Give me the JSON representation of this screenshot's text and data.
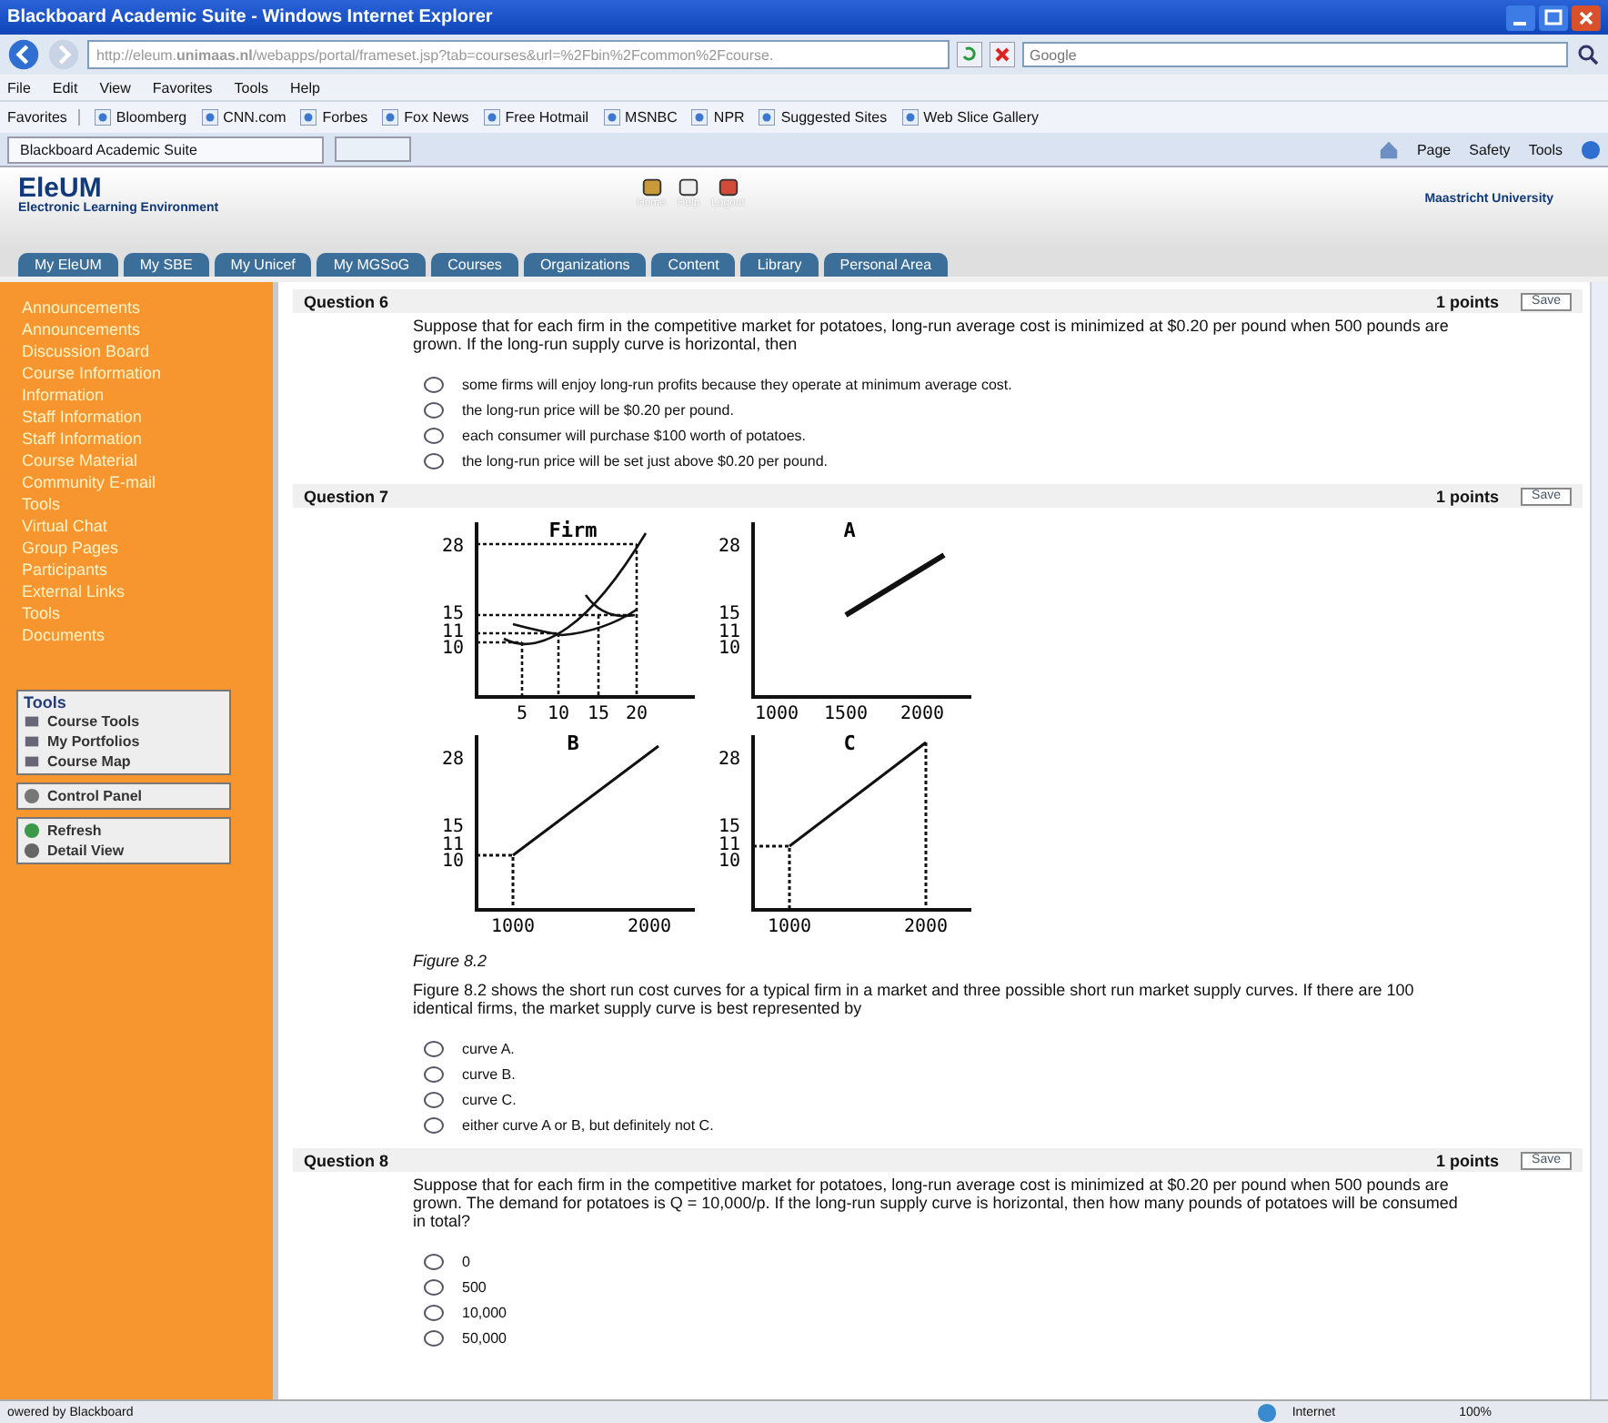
{
  "browser": {
    "title": "Blackboard Academic Suite - Windows Internet Explorer",
    "address": "http://eleum.**unimaas.nl**/webapps/portal/frameset.jsp?tab=courses&url=%2Fbin%2Fcommon%2Fcourse.",
    "search_placeholder": "Google",
    "menu": [
      "File",
      "Edit",
      "View",
      "Favorites",
      "Tools",
      "Help"
    ],
    "favorites_label": "Favorites",
    "favorites": [
      "Bloomberg",
      "CNN.com",
      "Forbes",
      "Fox News",
      "Free Hotmail",
      "MSNBC",
      "NPR",
      "Suggested Sites",
      "Web Slice Gallery"
    ],
    "tab_title": "Blackboard Academic Suite",
    "commands": [
      "Page",
      "Safety",
      "Tools"
    ]
  },
  "site": {
    "logo": "EleUM",
    "subtitle": "Electronic Learning Environment",
    "header_links": [
      "Home",
      "Help",
      "Logout"
    ],
    "university": "Maastricht University",
    "tabs": [
      "My EleUM",
      "My SBE",
      "My Unicef",
      "My MGSoG",
      "Courses",
      "Organizations",
      "Content",
      "Library",
      "Personal Area"
    ]
  },
  "sidebar": {
    "items": [
      "Announcements",
      "Announcements",
      "Discussion Board",
      "Course Information",
      "Information",
      "Staff Information",
      "Staff Information",
      "Course Material",
      "Community E-mail",
      "Tools",
      "Virtual Chat",
      "Group Pages",
      "Participants",
      "External Links",
      "Tools",
      "Documents"
    ],
    "tools_title": "Tools",
    "tools": [
      "Course Tools",
      "My Portfolios",
      "Course Map"
    ],
    "control_panel": "Control Panel",
    "actions": [
      "Refresh",
      "Detail View"
    ]
  },
  "questions": [
    {
      "label": "Question 6",
      "points": "1 points",
      "save": "Save",
      "text": "Suppose that for each firm in the competitive market for potatoes, long-run average cost is minimized at $0.20 per pound when 500 pounds are grown. If the long-run supply curve is horizontal, then",
      "options": [
        {
          "label": "some firms will enjoy long-run profits because they operate at minimum average cost.",
          "selected": false
        },
        {
          "label": "the long-run price will be $0.20 per pound.",
          "selected": false
        },
        {
          "label": "each consumer will purchase $100 worth of potatoes.",
          "selected": false
        },
        {
          "label": "the long-run price will be set just above $0.20 per pound.",
          "selected": false
        }
      ]
    },
    {
      "label": "Question 7",
      "points": "1 points",
      "save": "Save",
      "figure": {
        "caption": "Figure 8.2",
        "panels": [
          {
            "kind": "firm",
            "title": "Firm",
            "yticks": [
              "28",
              "15",
              "11",
              "10"
            ],
            "xticks": [
              "5",
              "10",
              "15",
              "20"
            ]
          },
          {
            "kind": "a",
            "title": "A",
            "yticks": [
              "28",
              "15",
              "11",
              "10"
            ],
            "xticks": [
              "1000",
              "1500",
              "2000"
            ]
          },
          {
            "kind": "b",
            "title": "B",
            "yticks": [
              "28",
              "15",
              "11",
              "10"
            ],
            "xticks": [
              "1000",
              "2000"
            ]
          },
          {
            "kind": "c",
            "title": "C",
            "yticks": [
              "28",
              "15",
              "11",
              "10"
            ],
            "xticks": [
              "1000",
              "2000"
            ]
          }
        ]
      },
      "text": "Figure 8.2 shows the short run cost curves for a typical firm in a market and three possible short run market supply curves. If there are 100 identical firms, the market supply curve is best represented by",
      "options": [
        {
          "label": "curve A.",
          "selected": false
        },
        {
          "label": "curve B.",
          "selected": false
        },
        {
          "label": "curve C.",
          "selected": false
        },
        {
          "label": "either curve A or B, but definitely not C.",
          "selected": false
        }
      ]
    },
    {
      "label": "Question 8",
      "points": "1 points",
      "save": "Save",
      "text": "Suppose that for each firm in the competitive market for potatoes, long-run average cost is minimized at $0.20 per pound when 500 pounds are grown. The demand for potatoes is Q = 10,000/p. If the long-run supply curve is horizontal, then how many pounds of potatoes will be consumed in total?",
      "options": [
        {
          "label": "0",
          "selected": false
        },
        {
          "label": "500",
          "selected": false
        },
        {
          "label": "10,000",
          "selected": false
        },
        {
          "label": "50,000",
          "selected": false
        }
      ]
    }
  ],
  "status": {
    "left": "owered by Blackboard",
    "zone": "Internet",
    "zoom": "100%"
  }
}
